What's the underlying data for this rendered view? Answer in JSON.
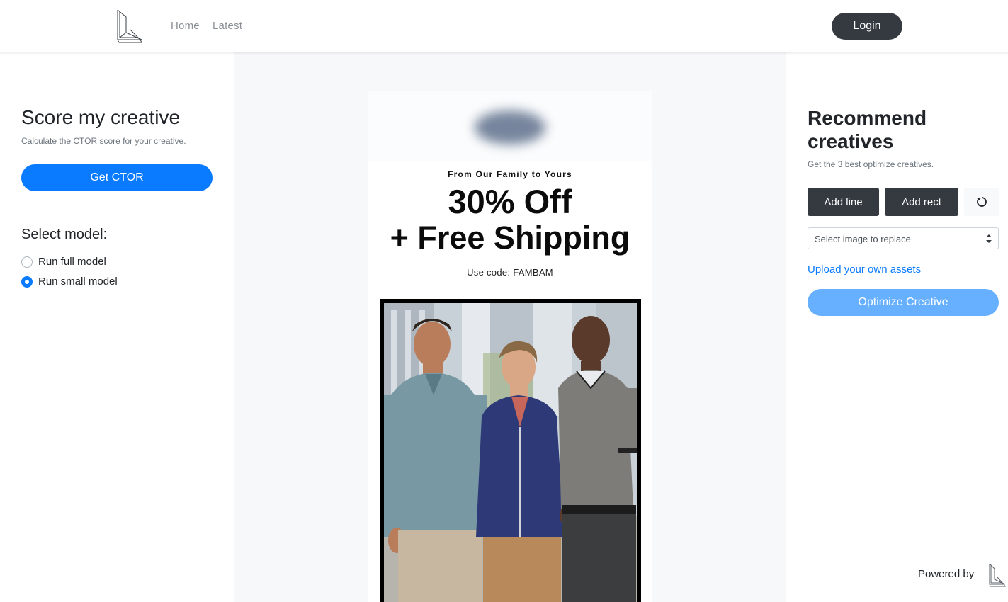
{
  "nav": {
    "logo_icon": "brand-logo-icon",
    "home_label": "Home",
    "latest_label": "Latest",
    "login_label": "Login"
  },
  "left": {
    "title": "Score my creative",
    "subtitle": "Calculate the CTOR score for your creative.",
    "button_label": "Get CTOR",
    "select_label": "Select model:",
    "options": [
      {
        "label": "Run full model",
        "checked": false
      },
      {
        "label": "Run small model",
        "checked": true
      }
    ]
  },
  "creative": {
    "kicker": "From Our Family to Yours",
    "headline": "30% Off",
    "subheadline": "+ Free Shipping",
    "code": "Use code: FAMBAM",
    "photo_icon": "three-men-photo"
  },
  "right": {
    "title": "Recommend creatives",
    "subtitle": "Get the 3 best optimize creatives.",
    "add_line_label": "Add line",
    "add_rect_label": "Add rect",
    "reset_icon": "reset-icon",
    "select_placeholder": "Select image to replace",
    "upload_label": "Upload your own assets",
    "optimize_label": "Optimize Creative",
    "powered_by": "Powered by"
  },
  "colors": {
    "primary": "#0a7bff",
    "primary_light": "#66b0ff",
    "dark": "#343a40"
  }
}
